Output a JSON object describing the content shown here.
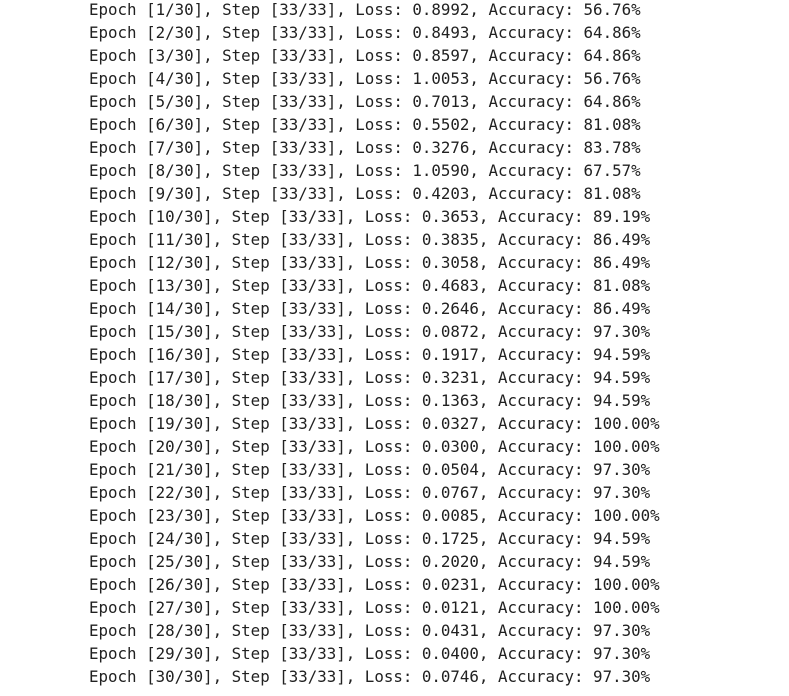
{
  "log_lines": [
    "Epoch [1/30], Step [33/33], Loss: 0.8992, Accuracy: 56.76%",
    "Epoch [2/30], Step [33/33], Loss: 0.8493, Accuracy: 64.86%",
    "Epoch [3/30], Step [33/33], Loss: 0.8597, Accuracy: 64.86%",
    "Epoch [4/30], Step [33/33], Loss: 1.0053, Accuracy: 56.76%",
    "Epoch [5/30], Step [33/33], Loss: 0.7013, Accuracy: 64.86%",
    "Epoch [6/30], Step [33/33], Loss: 0.5502, Accuracy: 81.08%",
    "Epoch [7/30], Step [33/33], Loss: 0.3276, Accuracy: 83.78%",
    "Epoch [8/30], Step [33/33], Loss: 1.0590, Accuracy: 67.57%",
    "Epoch [9/30], Step [33/33], Loss: 0.4203, Accuracy: 81.08%",
    "Epoch [10/30], Step [33/33], Loss: 0.3653, Accuracy: 89.19%",
    "Epoch [11/30], Step [33/33], Loss: 0.3835, Accuracy: 86.49%",
    "Epoch [12/30], Step [33/33], Loss: 0.3058, Accuracy: 86.49%",
    "Epoch [13/30], Step [33/33], Loss: 0.4683, Accuracy: 81.08%",
    "Epoch [14/30], Step [33/33], Loss: 0.2646, Accuracy: 86.49%",
    "Epoch [15/30], Step [33/33], Loss: 0.0872, Accuracy: 97.30%",
    "Epoch [16/30], Step [33/33], Loss: 0.1917, Accuracy: 94.59%",
    "Epoch [17/30], Step [33/33], Loss: 0.3231, Accuracy: 94.59%",
    "Epoch [18/30], Step [33/33], Loss: 0.1363, Accuracy: 94.59%",
    "Epoch [19/30], Step [33/33], Loss: 0.0327, Accuracy: 100.00%",
    "Epoch [20/30], Step [33/33], Loss: 0.0300, Accuracy: 100.00%",
    "Epoch [21/30], Step [33/33], Loss: 0.0504, Accuracy: 97.30%",
    "Epoch [22/30], Step [33/33], Loss: 0.0767, Accuracy: 97.30%",
    "Epoch [23/30], Step [33/33], Loss: 0.0085, Accuracy: 100.00%",
    "Epoch [24/30], Step [33/33], Loss: 0.1725, Accuracy: 94.59%",
    "Epoch [25/30], Step [33/33], Loss: 0.2020, Accuracy: 94.59%",
    "Epoch [26/30], Step [33/33], Loss: 0.0231, Accuracy: 100.00%",
    "Epoch [27/30], Step [33/33], Loss: 0.0121, Accuracy: 100.00%",
    "Epoch [28/30], Step [33/33], Loss: 0.0431, Accuracy: 97.30%",
    "Epoch [29/30], Step [33/33], Loss: 0.0400, Accuracy: 97.30%",
    "Epoch [30/30], Step [33/33], Loss: 0.0746, Accuracy: 97.30%"
  ]
}
